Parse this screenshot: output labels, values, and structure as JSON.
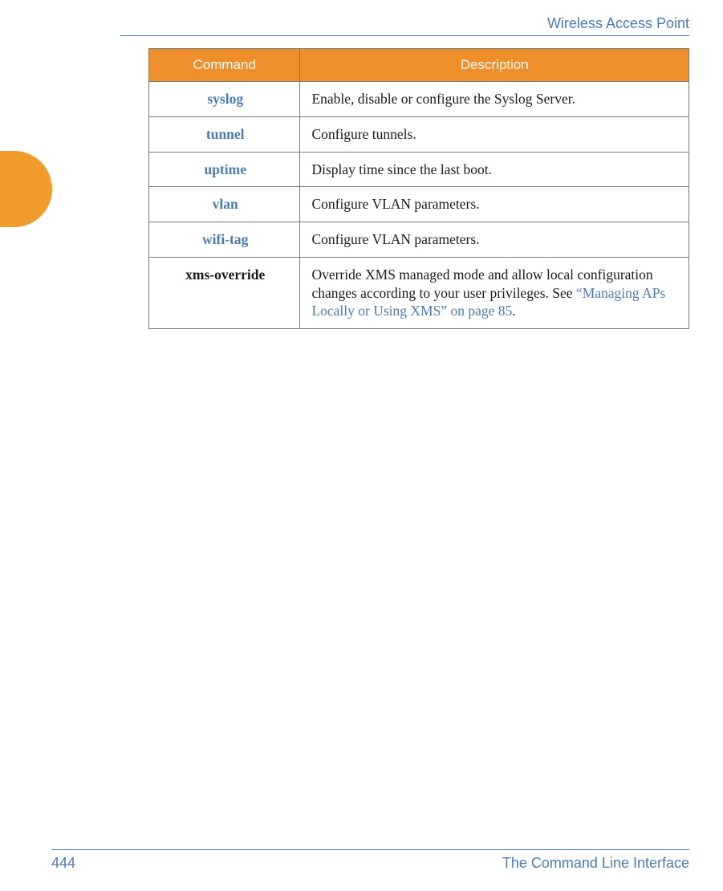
{
  "header": {
    "title": "Wireless Access Point"
  },
  "table": {
    "headers": {
      "command": "Command",
      "description": "Description"
    },
    "rows": [
      {
        "cmd": "syslog",
        "link": true,
        "desc": "Enable, disable or configure the Syslog Server."
      },
      {
        "cmd": "tunnel",
        "link": true,
        "desc": "Configure tunnels."
      },
      {
        "cmd": "uptime",
        "link": true,
        "desc": "Display time since the last boot."
      },
      {
        "cmd": "vlan",
        "link": true,
        "desc": "Configure VLAN parameters."
      },
      {
        "cmd": "wifi-tag",
        "link": true,
        "desc": "Configure VLAN parameters."
      },
      {
        "cmd": "xms-override",
        "link": false,
        "desc_prefix": "Override XMS managed mode and allow local configuration changes according to your user privileges. See ",
        "xref": "“Managing APs Locally or Using XMS” on page 85",
        "desc_suffix": "."
      }
    ]
  },
  "footer": {
    "page_number": "444",
    "section": "The Command Line Interface"
  }
}
